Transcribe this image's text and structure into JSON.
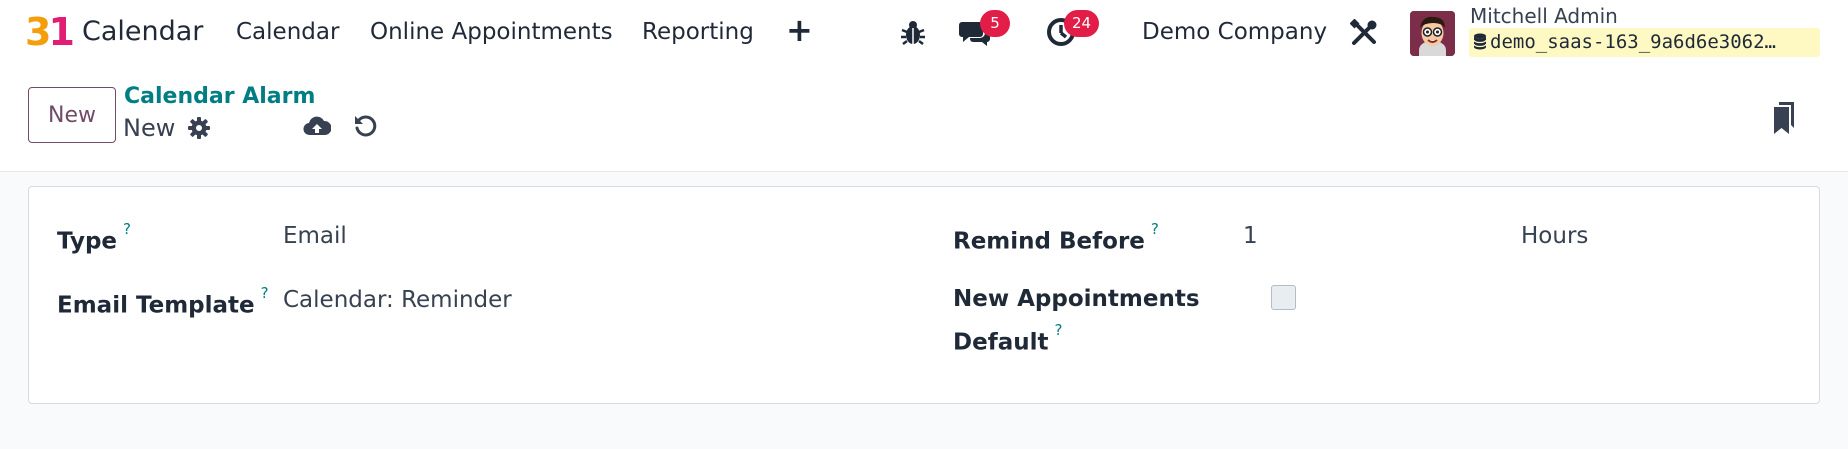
{
  "navbar": {
    "logo": "31",
    "app_name": "Calendar",
    "menu": [
      "Calendar",
      "Online Appointments",
      "Reporting"
    ],
    "plus_icon": "plus-icon",
    "debug_icon": "bug-icon",
    "messages_icon": "chat-icon",
    "messages_badge": "5",
    "activities_icon": "clock-icon",
    "activities_badge": "24",
    "company": "Demo Company",
    "settings_icon": "tools-icon",
    "user_name": "Mitchell Admin",
    "database": "demo_saas-163_9a6d6e3062…"
  },
  "control_panel": {
    "new_button": "New",
    "breadcrumb": "Calendar Alarm",
    "record_name": "New",
    "gear_icon": "gear-icon",
    "save_icon": "cloud-upload-icon",
    "discard_icon": "undo-icon",
    "bookmark_icon": "bookmarks-icon"
  },
  "form": {
    "type_label": "Type",
    "type_value": "Email",
    "template_label": "Email Template",
    "template_value": "Calendar: Reminder",
    "remind_label": "Remind Before",
    "remind_value": "1",
    "remind_unit": "Hours",
    "appointments_label_1": "New Appointments",
    "appointments_label_2": "Default",
    "appointments_default_checked": false,
    "help_marker": "?"
  },
  "colors": {
    "brand": "#714b67",
    "link": "#017e84",
    "badge": "#e11d48",
    "logo_orange": "#f59e0b",
    "logo_pink": "#e11d74"
  }
}
